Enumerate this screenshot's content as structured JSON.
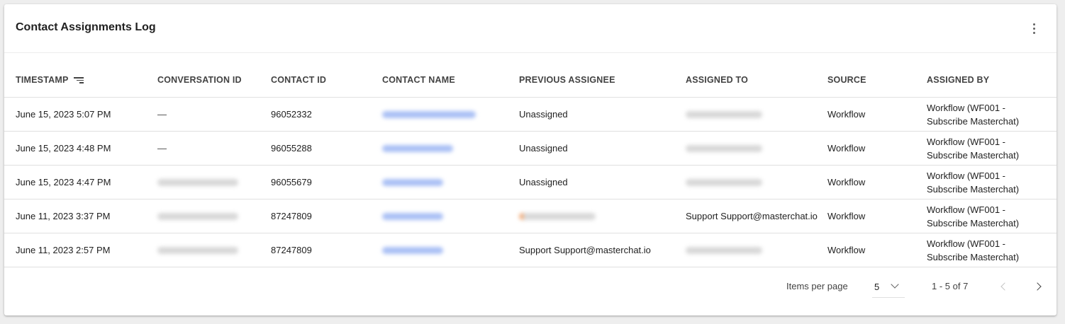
{
  "card": {
    "title": "Contact Assignments Log"
  },
  "columns": [
    "TIMESTAMP",
    "CONVERSATION ID",
    "CONTACT ID",
    "CONTACT NAME",
    "PREVIOUS ASSIGNEE",
    "ASSIGNED TO",
    "SOURCE",
    "ASSIGNED BY"
  ],
  "rows": [
    {
      "timestamp": "June 15, 2023 5:07 PM",
      "conversation_id": "—",
      "contact_id": "96052332",
      "previous_assignee": "Unassigned",
      "source": "Workflow",
      "assigned_by": "Workflow (WF001 - Subscribe Masterchat)"
    },
    {
      "timestamp": "June 15, 2023 4:48 PM",
      "conversation_id": "—",
      "contact_id": "96055288",
      "previous_assignee": "Unassigned",
      "source": "Workflow",
      "assigned_by": "Workflow (WF001 - Subscribe Masterchat)"
    },
    {
      "timestamp": "June 15, 2023 4:47 PM",
      "conversation_id": "",
      "contact_id": "96055679",
      "previous_assignee": "Unassigned",
      "source": "Workflow",
      "assigned_by": "Workflow (WF001 - Subscribe Masterchat)"
    },
    {
      "timestamp": "June 11, 2023 3:37 PM",
      "conversation_id": "",
      "contact_id": "87247809",
      "previous_assignee": "",
      "assigned_to": "Support Support@masterchat.io",
      "source": "Workflow",
      "assigned_by": "Workflow (WF001 - Subscribe Masterchat)"
    },
    {
      "timestamp": "June 11, 2023 2:57 PM",
      "conversation_id": "",
      "contact_id": "87247809",
      "previous_assignee": "Support Support@masterchat.io",
      "source": "Workflow",
      "assigned_by": "Workflow (WF001 - Subscribe Masterchat)"
    }
  ],
  "pagination": {
    "items_per_page_label": "Items per page",
    "items_per_page": "5",
    "range_label": "1 - 5 of 7"
  },
  "icons": {
    "more": "more-vert-icon",
    "sort": "sort-icon",
    "dropdown": "chevron-down-icon",
    "prev": "chevron-left-icon",
    "next": "chevron-right-icon"
  },
  "colors": {
    "link": "#4f7de6",
    "header_text": "#424242",
    "border": "#e0e0e0"
  }
}
